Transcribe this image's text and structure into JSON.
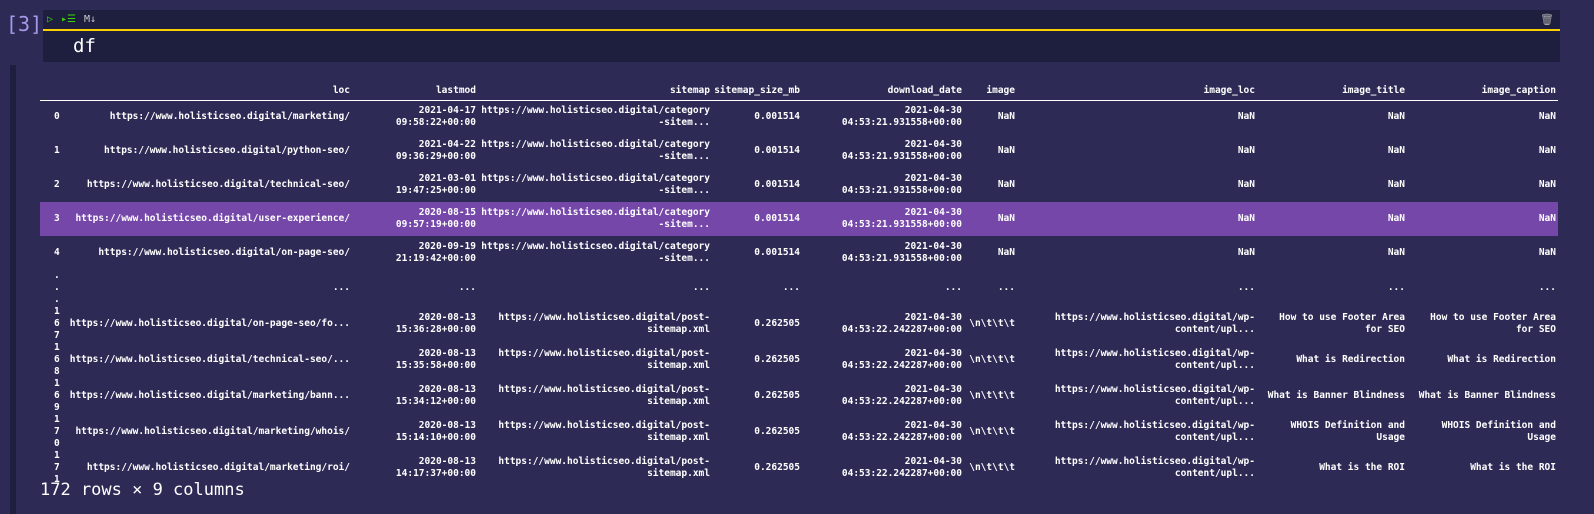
{
  "cell": {
    "prompt": "[3]",
    "code": "df",
    "toolbar": {
      "run": "▷",
      "run_below": "▸☰",
      "markdown": "M↓",
      "delete": "🗑"
    }
  },
  "table": {
    "columns": [
      "",
      "loc",
      "lastmod",
      "sitemap",
      "sitemap_size_mb",
      "download_date",
      "image",
      "image_loc",
      "image_title",
      "image_caption"
    ],
    "rows": [
      [
        "0",
        "https://www.holisticseo.digital/marketing/",
        "2021-04-17 09:58:22+00:00",
        "https://www.holisticseo.digital/category-sitem...",
        "0.001514",
        "2021-04-30 04:53:21.931558+00:00",
        "NaN",
        "NaN",
        "NaN",
        "NaN"
      ],
      [
        "1",
        "https://www.holisticseo.digital/python-seo/",
        "2021-04-22 09:36:29+00:00",
        "https://www.holisticseo.digital/category-sitem...",
        "0.001514",
        "2021-04-30 04:53:21.931558+00:00",
        "NaN",
        "NaN",
        "NaN",
        "NaN"
      ],
      [
        "2",
        "https://www.holisticseo.digital/technical-seo/",
        "2021-03-01 19:47:25+00:00",
        "https://www.holisticseo.digital/category-sitem...",
        "0.001514",
        "2021-04-30 04:53:21.931558+00:00",
        "NaN",
        "NaN",
        "NaN",
        "NaN"
      ],
      [
        "3",
        "https://www.holisticseo.digital/user-experience/",
        "2020-08-15 09:57:19+00:00",
        "https://www.holisticseo.digital/category-sitem...",
        "0.001514",
        "2021-04-30 04:53:21.931558+00:00",
        "NaN",
        "NaN",
        "NaN",
        "NaN"
      ],
      [
        "4",
        "https://www.holisticseo.digital/on-page-seo/",
        "2020-09-19 21:19:42+00:00",
        "https://www.holisticseo.digital/category-sitem...",
        "0.001514",
        "2021-04-30 04:53:21.931558+00:00",
        "NaN",
        "NaN",
        "NaN",
        "NaN"
      ],
      [
        "...",
        "...",
        "...",
        "...",
        "...",
        "...",
        "...",
        "...",
        "...",
        "..."
      ],
      [
        "167",
        "https://www.holisticseo.digital/on-page-seo/fo...",
        "2020-08-13 15:36:28+00:00",
        "https://www.holisticseo.digital/post-sitemap.xml",
        "0.262505",
        "2021-04-30 04:53:22.242287+00:00",
        "\\n\\t\\t\\t",
        "https://www.holisticseo.digital/wp-content/upl...",
        "How to use Footer Area for SEO",
        "How to use Footer Area for SEO"
      ],
      [
        "168",
        "https://www.holisticseo.digital/technical-seo/...",
        "2020-08-13 15:35:58+00:00",
        "https://www.holisticseo.digital/post-sitemap.xml",
        "0.262505",
        "2021-04-30 04:53:22.242287+00:00",
        "\\n\\t\\t\\t",
        "https://www.holisticseo.digital/wp-content/upl...",
        "What is Redirection",
        "What is Redirection"
      ],
      [
        "169",
        "https://www.holisticseo.digital/marketing/bann...",
        "2020-08-13 15:34:12+00:00",
        "https://www.holisticseo.digital/post-sitemap.xml",
        "0.262505",
        "2021-04-30 04:53:22.242287+00:00",
        "\\n\\t\\t\\t",
        "https://www.holisticseo.digital/wp-content/upl...",
        "What is Banner Blindness",
        "What is Banner Blindness"
      ],
      [
        "170",
        "https://www.holisticseo.digital/marketing/whois/",
        "2020-08-13 15:14:10+00:00",
        "https://www.holisticseo.digital/post-sitemap.xml",
        "0.262505",
        "2021-04-30 04:53:22.242287+00:00",
        "\\n\\t\\t\\t",
        "https://www.holisticseo.digital/wp-content/upl...",
        "WHOIS Definition and Usage",
        "WHOIS Definition and Usage"
      ],
      [
        "171",
        "https://www.holisticseo.digital/marketing/roi/",
        "2020-08-13 14:17:37+00:00",
        "https://www.holisticseo.digital/post-sitemap.xml",
        "0.262505",
        "2021-04-30 04:53:22.242287+00:00",
        "\\n\\t\\t\\t",
        "https://www.holisticseo.digital/wp-content/upl...",
        "What is the ROI",
        "What is the ROI"
      ]
    ],
    "highlighted_row": 3
  },
  "footer": "172 rows × 9 columns",
  "colors": {
    "background": "#2d2b55",
    "cell_input": "#1e1e3f",
    "active_border": "#fad000",
    "highlight": "#7447a8",
    "prompt": "#a599e9"
  }
}
